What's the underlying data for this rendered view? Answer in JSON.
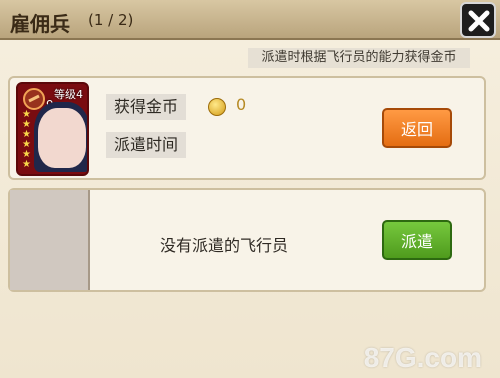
{
  "header": {
    "title": "雇佣兵",
    "pager": "(1 / 2)"
  },
  "subtitle": "派遣时根据飞行员的能力获得金币",
  "card1": {
    "level_label": "等级",
    "level_value": "4",
    "rank_value": "9",
    "gold_label": "获得金币",
    "gold_value": "0",
    "time_label": "派遣时间",
    "return_button": "返回"
  },
  "card2": {
    "empty_text": "没有派遣的飞行员",
    "dispatch_button": "派遣"
  },
  "watermark": "87G.com",
  "colors": {
    "orange_button": "#f07f24",
    "green_button": "#5fae28",
    "panel_bg": "#f4ecd8"
  }
}
